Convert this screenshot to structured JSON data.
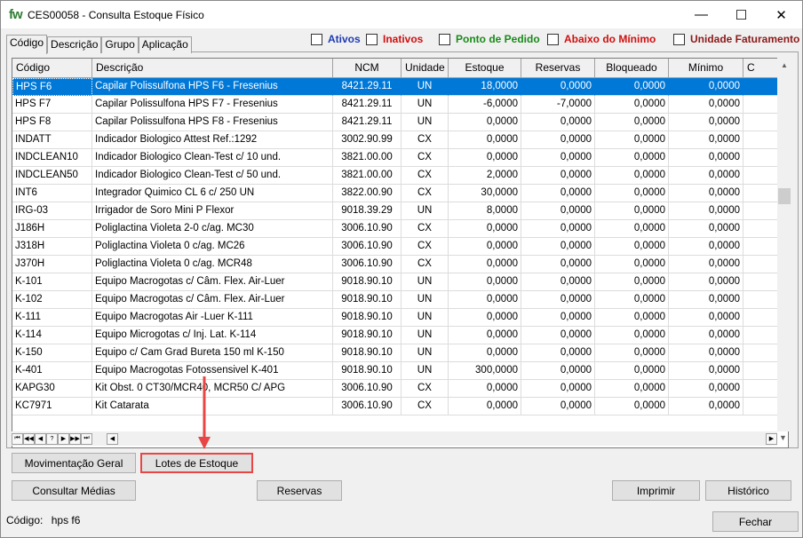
{
  "window": {
    "logo": "fw",
    "title": "CES00058 - Consulta Estoque Físico",
    "controls": {
      "minimize": "—",
      "maximize": "☐",
      "close": "✕"
    }
  },
  "tabs": [
    {
      "label": "Código",
      "active": true
    },
    {
      "label": "Descrição",
      "active": false
    },
    {
      "label": "Grupo",
      "active": false
    },
    {
      "label": "Aplicação",
      "active": false
    }
  ],
  "filters": [
    {
      "label": "Ativos",
      "color": "#1f3bb3",
      "checked": false
    },
    {
      "label": "Inativos",
      "color": "#d01010",
      "checked": false
    },
    {
      "label": "Ponto de Pedido",
      "color": "#1a8a1a",
      "checked": false
    },
    {
      "label": "Abaixo do Mínimo",
      "color": "#d01010",
      "checked": false
    },
    {
      "label": "Unidade Faturamento",
      "color": "#8b1a1a",
      "checked": false
    }
  ],
  "grid": {
    "columns": [
      "Código",
      "Descrição",
      "NCM",
      "Unidade",
      "Estoque",
      "Reservas",
      "Bloqueado",
      "Mínimo",
      "C"
    ],
    "rows": [
      {
        "code": "HPS F6",
        "desc": "Capilar Polissulfona HPS F6 - Fresenius",
        "ncm": "8421.29.11",
        "un": "UN",
        "est": "18,0000",
        "res": "0,0000",
        "blo": "0,0000",
        "min": "0,0000",
        "selected": true
      },
      {
        "code": "HPS F7",
        "desc": "Capilar Polissulfona HPS F7 - Fresenius",
        "ncm": "8421.29.11",
        "un": "UN",
        "est": "-6,0000",
        "res": "-7,0000",
        "blo": "0,0000",
        "min": "0,0000"
      },
      {
        "code": "HPS F8",
        "desc": "Capilar Polissulfona HPS F8 - Fresenius",
        "ncm": "8421.29.11",
        "un": "UN",
        "est": "0,0000",
        "res": "0,0000",
        "blo": "0,0000",
        "min": "0,0000"
      },
      {
        "code": "INDATT",
        "desc": "Indicador Biologico Attest Ref.:1292",
        "ncm": "3002.90.99",
        "un": "CX",
        "est": "0,0000",
        "res": "0,0000",
        "blo": "0,0000",
        "min": "0,0000"
      },
      {
        "code": "INDCLEAN10",
        "desc": "Indicador Biologico Clean-Test c/ 10 und.",
        "ncm": "3821.00.00",
        "un": "CX",
        "est": "0,0000",
        "res": "0,0000",
        "blo": "0,0000",
        "min": "0,0000"
      },
      {
        "code": "INDCLEAN50",
        "desc": "Indicador Biologico Clean-Test c/ 50 und.",
        "ncm": "3821.00.00",
        "un": "CX",
        "est": "2,0000",
        "res": "0,0000",
        "blo": "0,0000",
        "min": "0,0000"
      },
      {
        "code": "INT6",
        "desc": "Integrador Quimico CL 6 c/ 250 UN",
        "ncm": "3822.00.90",
        "un": "CX",
        "est": "30,0000",
        "res": "0,0000",
        "blo": "0,0000",
        "min": "0,0000"
      },
      {
        "code": "IRG-03",
        "desc": "Irrigador de Soro Mini P Flexor",
        "ncm": "9018.39.29",
        "un": "UN",
        "est": "8,0000",
        "res": "0,0000",
        "blo": "0,0000",
        "min": "0,0000"
      },
      {
        "code": "J186H",
        "desc": "Poliglactina Violeta 2-0 c/ag. MC30",
        "ncm": "3006.10.90",
        "un": "CX",
        "est": "0,0000",
        "res": "0,0000",
        "blo": "0,0000",
        "min": "0,0000"
      },
      {
        "code": "J318H",
        "desc": "Poliglactina Violeta 0 c/ag. MC26",
        "ncm": "3006.10.90",
        "un": "CX",
        "est": "0,0000",
        "res": "0,0000",
        "blo": "0,0000",
        "min": "0,0000"
      },
      {
        "code": "J370H",
        "desc": "Poliglactina Violeta 0 c/ag. MCR48",
        "ncm": "3006.10.90",
        "un": "CX",
        "est": "0,0000",
        "res": "0,0000",
        "blo": "0,0000",
        "min": "0,0000"
      },
      {
        "code": "K-101",
        "desc": "Equipo Macrogotas c/ Câm. Flex. Air-Luer",
        "ncm": "9018.90.10",
        "un": "UN",
        "est": "0,0000",
        "res": "0,0000",
        "blo": "0,0000",
        "min": "0,0000"
      },
      {
        "code": "K-102",
        "desc": "Equipo Macrogotas c/ Câm. Flex. Air-Luer",
        "ncm": "9018.90.10",
        "un": "UN",
        "est": "0,0000",
        "res": "0,0000",
        "blo": "0,0000",
        "min": "0,0000"
      },
      {
        "code": "K-111",
        "desc": "Equipo Macrogotas Air -Luer K-111",
        "ncm": "9018.90.10",
        "un": "UN",
        "est": "0,0000",
        "res": "0,0000",
        "blo": "0,0000",
        "min": "0,0000"
      },
      {
        "code": "K-114",
        "desc": "Equipo Microgotas c/ Inj. Lat. K-114",
        "ncm": "9018.90.10",
        "un": "UN",
        "est": "0,0000",
        "res": "0,0000",
        "blo": "0,0000",
        "min": "0,0000"
      },
      {
        "code": "K-150",
        "desc": "Equipo c/ Cam Grad Bureta 150 ml K-150",
        "ncm": "9018.90.10",
        "un": "UN",
        "est": "0,0000",
        "res": "0,0000",
        "blo": "0,0000",
        "min": "0,0000"
      },
      {
        "code": "K-401",
        "desc": "Equipo Macrogotas Fotossensivel K-401",
        "ncm": "9018.90.10",
        "un": "UN",
        "est": "300,0000",
        "res": "0,0000",
        "blo": "0,0000",
        "min": "0,0000"
      },
      {
        "code": "KAPG30",
        "desc": "Kit Obst. 0 CT30/MCR40, MCR50 C/ APG",
        "ncm": "3006.10.90",
        "un": "CX",
        "est": "0,0000",
        "res": "0,0000",
        "blo": "0,0000",
        "min": "0,0000"
      },
      {
        "code": "KC7971",
        "desc": "Kit Catarata",
        "ncm": "3006.10.90",
        "un": "CX",
        "est": "0,0000",
        "res": "0,0000",
        "blo": "0,0000",
        "min": "0,0000"
      }
    ]
  },
  "navigator": [
    "⏮",
    "◀◀",
    "◀",
    "?",
    "▶",
    "▶▶",
    "⏭",
    "◀"
  ],
  "buttons": {
    "movimentacao": "Movimentação Geral",
    "lotes": "Lotes de Estoque",
    "consultar_medias": "Consultar Médias",
    "reservas": "Reservas",
    "imprimir": "Imprimir",
    "historico": "Histórico",
    "fechar": "Fechar"
  },
  "status": {
    "label": "Código:",
    "value": "hps f6"
  },
  "colors": {
    "selection": "#0078d7",
    "annotation": "#e84545"
  }
}
